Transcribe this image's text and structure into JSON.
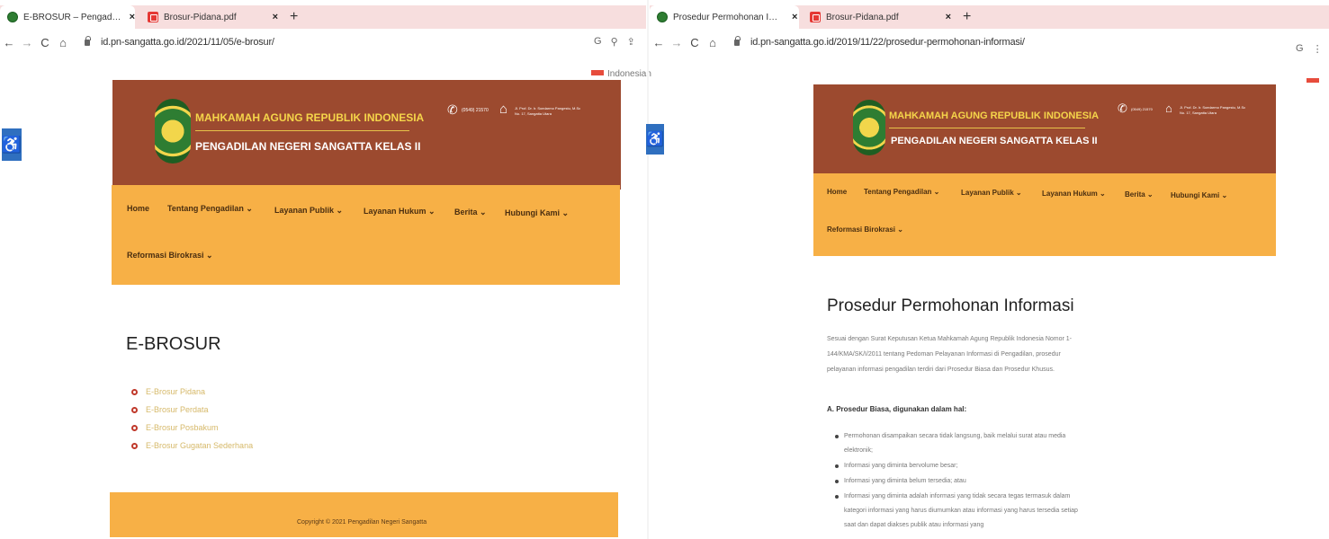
{
  "left_window": {
    "tabs": [
      {
        "title": "E-BROSUR – Pengadilan Neger",
        "close": "×"
      },
      {
        "title": "Brosur-Pidana.pdf",
        "close": "×"
      }
    ],
    "new_tab": "+",
    "url": "id.pn-sangatta.go.id/2021/11/05/e-brosur/",
    "language": "Indonesian",
    "page_title": "E-BROSUR",
    "brochure_links": [
      "E-Brosur Pidana",
      "E-Brosur Perdata",
      "E-Brosur Posbakum",
      "E-Brosur Gugatan Sederhana"
    ],
    "footer": "Copyright © 2021 Pengadilan Negeri Sangatta"
  },
  "right_window": {
    "tabs": [
      {
        "title": "Prosedur Permohonan Informasi",
        "close": "×"
      },
      {
        "title": "Brosur-Pidana.pdf",
        "close": "×"
      }
    ],
    "new_tab": "+",
    "url": "id.pn-sangatta.go.id/2019/11/22/prosedur-permohonan-informasi/",
    "page_title": "Prosedur Permohonan Informasi",
    "intro": "Sesuai dengan Surat Keputusan Ketua Mahkamah Agung Republik Indonesia Nomor 1-144/KMA/SK/I/2011 tentang Pedoman Pelayanan Informasi di Pengadilan, prosedur pelayanan informasi pengadilan terdiri dari Prosedur Biasa dan Prosedur Khusus.",
    "section_a": "A. Prosedur Biasa, digunakan dalam hal:",
    "conditions": [
      "Permohonan disampaikan secara tidak langsung, baik melalui surat atau media elektronik;",
      "Informasi yang diminta bervolume besar;",
      "Informasi yang diminta belum tersedia; atau",
      "Informasi yang diminta adalah informasi yang tidak secara tegas termasuk dalam kategori informasi yang harus diumumkan atau informasi yang harus tersedia setiap saat dan dapat diakses publik atau informasi yang"
    ]
  },
  "site": {
    "supreme_court": "MAHKAMAH AGUNG REPUBLIK INDONESIA",
    "court_name": "PENGADILAN NEGERI SANGATTA KELAS II",
    "phone": "(0549) 21570",
    "address": [
      "Jl. Prof. Dr. Ir. Soedarmo Pangestu, M.Sc",
      "No. 17, Sangatta Utara"
    ],
    "nav": [
      "Home",
      "Tentang Pengadilan ⌄",
      "Layanan Publik ⌄",
      "Layanan Hukum ⌄",
      "Berita ⌄",
      "Hubungi Kami ⌄",
      "Reformasi Birokrasi ⌄"
    ]
  },
  "icons": {
    "accessibility": "♿",
    "back": "←",
    "forward": "→",
    "reload": "C",
    "home": "⌂",
    "phone": "✆",
    "building": "⌂"
  },
  "colors": {
    "header": "#9c4a2f",
    "nav": "#f7b046",
    "court_gold": "#f5d54a",
    "accessibility": "#2f6fbf"
  }
}
